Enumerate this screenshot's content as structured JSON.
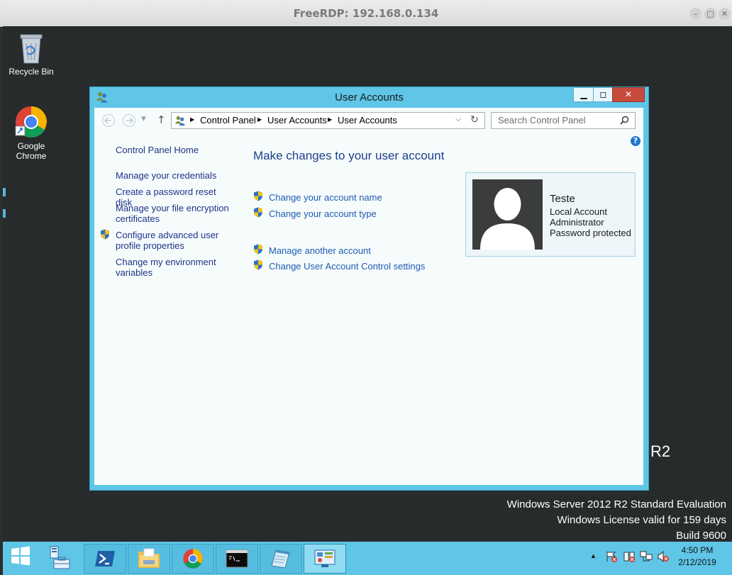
{
  "rdp": {
    "title": "FreeRDP: 192.168.0.134"
  },
  "desktop": {
    "icons": [
      {
        "label": "Recycle Bin"
      },
      {
        "label": "Google Chrome"
      }
    ],
    "r2": "R2",
    "watermark": {
      "line1": "Windows Server 2012 R2 Standard Evaluation",
      "line2": "Windows License valid for 159 days",
      "line3": "Build 9600"
    }
  },
  "window": {
    "title": "User Accounts",
    "breadcrumb": [
      "Control Panel",
      "User Accounts",
      "User Accounts"
    ],
    "search_placeholder": "Search Control Panel",
    "sidebar": {
      "home": "Control Panel Home",
      "items": [
        "Manage your credentials",
        "Create a password reset disk",
        "Manage your file encryption certificates",
        "Configure advanced user profile properties",
        "Change my environment variables"
      ]
    },
    "heading": "Make changes to your user account",
    "tasks": [
      "Change your account name",
      "Change your account type",
      "Manage another account",
      "Change User Account Control settings"
    ],
    "account": {
      "name": "Teste",
      "type": "Local Account",
      "role": "Administrator",
      "status": "Password protected"
    }
  },
  "taskbar": {
    "time": "4:50 PM",
    "date": "2/12/2019"
  },
  "colors": {
    "accent": "#5fc6e7",
    "link": "#1e3287",
    "heading": "#1d5ab3"
  }
}
